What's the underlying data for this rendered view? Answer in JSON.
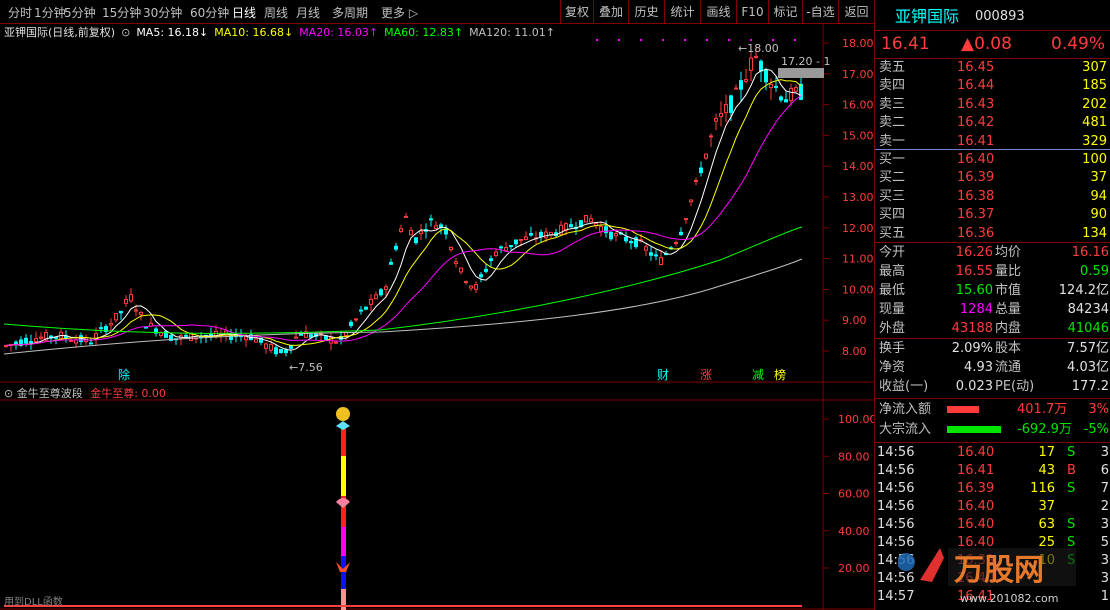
{
  "toolbar": {
    "periods": [
      "分时",
      "1分钟",
      "5分钟",
      "15分钟",
      "30分钟",
      "60分钟",
      "日线",
      "周线",
      "月线",
      "多周期",
      "更多 ▷"
    ],
    "active_period": "日线",
    "buttons": [
      "复权",
      "叠加",
      "历史",
      "统计",
      "画线",
      "F10",
      "标记",
      "-自选",
      "返回"
    ]
  },
  "ma_line": {
    "title": "亚钾国际(日线,前复权)",
    "items": [
      {
        "label": "MA5: 16.18↓",
        "color": "#ffffff"
      },
      {
        "label": "MA10: 16.68↓",
        "color": "#ffff00"
      },
      {
        "label": "MA20: 16.03↑",
        "color": "#ff00ff"
      },
      {
        "label": "MA60: 12.83↑",
        "color": "#00ff00"
      },
      {
        "label": "MA120: 11.01↑",
        "color": "#c0c0c0"
      }
    ]
  },
  "price_axis": [
    "18.00",
    "17.00",
    "16.00",
    "15.00",
    "14.00",
    "13.00",
    "12.00",
    "11.00",
    "10.00",
    "9.00",
    "8.00"
  ],
  "price_annotations": {
    "high": "18.00",
    "low": "7.56",
    "last": "17.20 - 1"
  },
  "event_markers": [
    {
      "label": "除",
      "color": "#00ffff"
    },
    {
      "label": "财",
      "color": "#00ffff"
    },
    {
      "label": "涨",
      "color": "#ff3c3c"
    },
    {
      "label": "减",
      "color": "#00ff00"
    },
    {
      "label": "榜",
      "color": "#ffff00"
    }
  ],
  "indicator": {
    "name": "金牛至尊波段",
    "value_label": "金牛至尊: 0.00",
    "axis": [
      "100.00",
      "80.00",
      "60.00",
      "40.00",
      "20.00"
    ],
    "footer": "用到DLL函数"
  },
  "stock": {
    "name": "亚钾国际",
    "code": "000893",
    "price": "16.41",
    "change": "▲0.08",
    "pct": "0.49%"
  },
  "sell": [
    {
      "label": "卖五",
      "price": "16.45",
      "vol": "307"
    },
    {
      "label": "卖四",
      "price": "16.44",
      "vol": "185"
    },
    {
      "label": "卖三",
      "price": "16.43",
      "vol": "202"
    },
    {
      "label": "卖二",
      "price": "16.42",
      "vol": "481"
    },
    {
      "label": "卖一",
      "price": "16.41",
      "vol": "329"
    }
  ],
  "buy": [
    {
      "label": "买一",
      "price": "16.40",
      "vol": "100"
    },
    {
      "label": "买二",
      "price": "16.39",
      "vol": "37"
    },
    {
      "label": "买三",
      "price": "16.38",
      "vol": "94"
    },
    {
      "label": "买四",
      "price": "16.37",
      "vol": "90"
    },
    {
      "label": "买五",
      "price": "16.36",
      "vol": "134"
    }
  ],
  "quote": [
    {
      "l1": "今开",
      "v1": "16.26",
      "c1": "red",
      "l2": "均价",
      "v2": "16.16",
      "c2": "red"
    },
    {
      "l1": "最高",
      "v1": "16.55",
      "c1": "red",
      "l2": "量比",
      "v2": "0.59",
      "c2": "green"
    },
    {
      "l1": "最低",
      "v1": "15.60",
      "c1": "green",
      "l2": "市值",
      "v2": "124.2亿",
      "c2": "white"
    },
    {
      "l1": "现量",
      "v1": "1284",
      "c1": "mag",
      "l2": "总量",
      "v2": "84234",
      "c2": "white"
    },
    {
      "l1": "外盘",
      "v1": "43188",
      "c1": "red",
      "l2": "内盘",
      "v2": "41046",
      "c2": "green"
    }
  ],
  "stats": [
    {
      "l1": "换手",
      "v1": "2.09%",
      "l2": "股本",
      "v2": "7.57亿"
    },
    {
      "l1": "净资",
      "v1": "4.93",
      "l2": "流通",
      "v2": "4.03亿"
    },
    {
      "l1": "收益(一)",
      "v1": "0.023",
      "l2": "PE(动)",
      "v2": "177.2"
    }
  ],
  "flows": [
    {
      "label": "净流入额",
      "value": "401.7万",
      "pct": "3%",
      "color": "#ff3c3c"
    },
    {
      "label": "大宗流入",
      "value": "-692.9万",
      "pct": "-5%",
      "color": "#00e600"
    }
  ],
  "ticks": [
    {
      "t": "14:56",
      "p": "16.40",
      "v": "17",
      "d": "S",
      "n": "3"
    },
    {
      "t": "14:56",
      "p": "16.41",
      "v": "43",
      "d": "B",
      "n": "6"
    },
    {
      "t": "14:56",
      "p": "16.39",
      "v": "116",
      "d": "S",
      "n": "7"
    },
    {
      "t": "14:56",
      "p": "16.40",
      "v": "37",
      "d": "",
      "n": "2"
    },
    {
      "t": "14:56",
      "p": "16.40",
      "v": "63",
      "d": "S",
      "n": "3"
    },
    {
      "t": "14:56",
      "p": "16.40",
      "v": "25",
      "d": "S",
      "n": "5"
    },
    {
      "t": "14:56",
      "p": "16.39",
      "v": "10",
      "d": "S",
      "n": "3"
    },
    {
      "t": "14:56",
      "p": "16.40",
      "v": "",
      "d": "",
      "n": "3"
    },
    {
      "t": "14:57",
      "p": "16.41",
      "v": "",
      "d": "",
      "n": "1"
    }
  ],
  "watermark": {
    "brand": "万股网",
    "url": "www.201082.com"
  },
  "colors": {
    "up": "#ff3c3c",
    "down": "#00ffff",
    "border": "#800000"
  }
}
